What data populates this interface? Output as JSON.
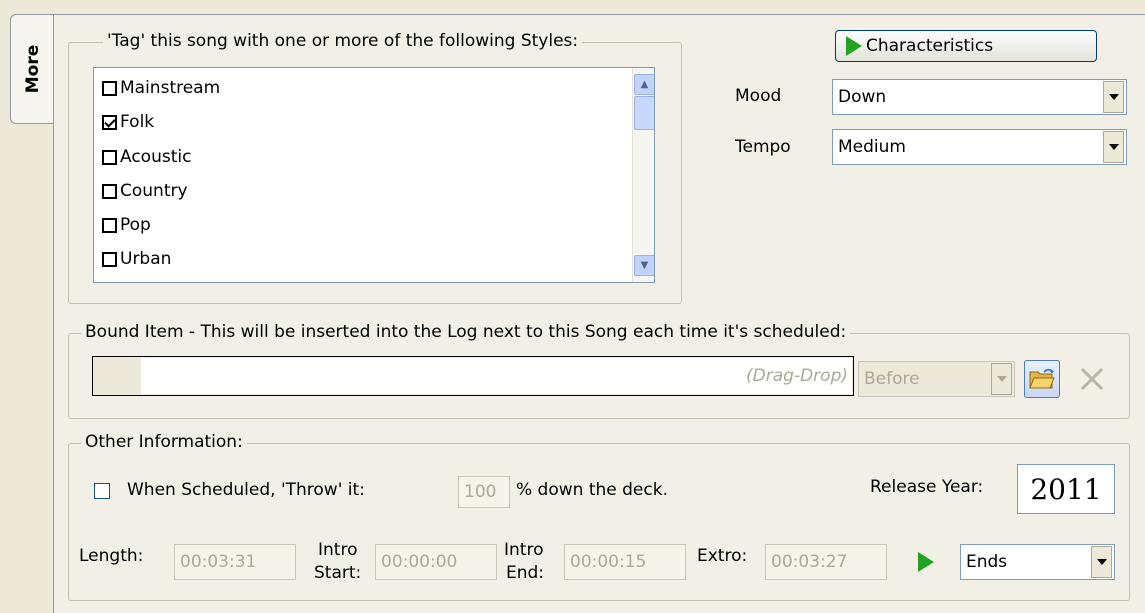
{
  "tabs": {
    "more_label": "More"
  },
  "styles_group": {
    "legend": "'Tag' this song with one or more of the following Styles:",
    "items": [
      {
        "label": "Mainstream",
        "checked": false
      },
      {
        "label": "Folk",
        "checked": true
      },
      {
        "label": "Acoustic",
        "checked": false
      },
      {
        "label": "Country",
        "checked": false
      },
      {
        "label": "Pop",
        "checked": false
      },
      {
        "label": "Urban",
        "checked": false
      }
    ]
  },
  "characteristics": {
    "button_label": "Characteristics",
    "icon": "play-icon",
    "mood_label": "Mood",
    "mood_value": "Down",
    "tempo_label": "Tempo",
    "tempo_value": "Medium"
  },
  "bound_item": {
    "legend": "Bound Item - This will be inserted into the Log next to this Song each time it's scheduled:",
    "placeholder": "(Drag-Drop)",
    "position_value": "Before",
    "browse_icon": "folder-open-icon",
    "clear_icon": "close-icon"
  },
  "other_info": {
    "legend": "Other Information:",
    "throw_label": "When Scheduled, 'Throw' it:",
    "throw_checked": false,
    "throw_percent": "100",
    "throw_suffix": "% down the deck.",
    "release_year_label": "Release Year:",
    "release_year": "2011",
    "length_label": "Length:",
    "length_value": "00:03:31",
    "intro_start_label_1": "Intro",
    "intro_start_label_2": "Start:",
    "intro_start_value": "00:00:00",
    "intro_end_label_1": "Intro",
    "intro_end_label_2": "End:",
    "intro_end_value": "00:00:15",
    "extro_label": "Extro:",
    "extro_value": "00:03:27",
    "play_icon": "play-icon",
    "ending_value": "Ends"
  },
  "colors": {
    "background": "#ece9d8",
    "accent_border": "#7f9db9",
    "play_green": "#22a322"
  }
}
